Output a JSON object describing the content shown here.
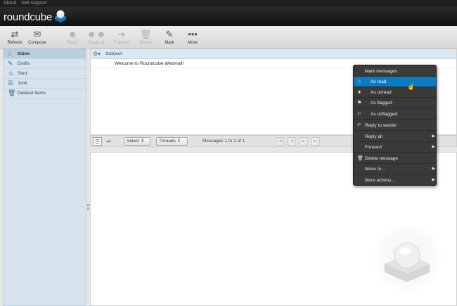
{
  "topbar": {
    "about": "About",
    "support": "Get support"
  },
  "header": {
    "logo_text": "roundcube",
    "brand_color": "#2b8bd1"
  },
  "toolbar": {
    "buttons": [
      {
        "label": "Refresh",
        "icon": "refresh-icon",
        "enabled": true
      },
      {
        "label": "Compose",
        "icon": "compose-icon",
        "enabled": true
      },
      {
        "label": "Reply",
        "icon": "reply-icon",
        "enabled": false
      },
      {
        "label": "Reply all",
        "icon": "reply-all-icon",
        "enabled": false
      },
      {
        "label": "Forward",
        "icon": "forward-icon",
        "enabled": false
      },
      {
        "label": "Delete",
        "icon": "trash-icon",
        "enabled": false
      },
      {
        "label": "Mark",
        "icon": "pencil-icon",
        "enabled": true
      },
      {
        "label": "More",
        "icon": "more-icon",
        "enabled": true
      }
    ]
  },
  "folders": [
    {
      "label": "Inbox",
      "icon": "inbox-icon",
      "active": true
    },
    {
      "label": "Drafts",
      "icon": "pencil-icon",
      "active": false
    },
    {
      "label": "Sent",
      "icon": "sent-icon",
      "active": false
    },
    {
      "label": "Junk",
      "icon": "junk-icon",
      "active": false
    },
    {
      "label": "Deleted Items",
      "icon": "trash-icon",
      "active": false
    }
  ],
  "message_list": {
    "column_subject": "Subject",
    "messages": [
      {
        "subject": "Welcome to Roundcube Webmail!"
      }
    ]
  },
  "list_footer": {
    "select_label": "Select",
    "threads_label": "Threads",
    "count_text": "Messages 1 to 1 of 1"
  },
  "context_menu": {
    "title": "Mark messages",
    "items": [
      {
        "label": "As read",
        "icon": "star-outline-icon",
        "highlighted": true
      },
      {
        "label": "As unread",
        "icon": "star-icon"
      },
      {
        "label": "As flagged",
        "icon": "flag-icon"
      },
      {
        "label": "As unflagged",
        "icon": "flag-outline-icon"
      },
      {
        "label": "Reply to sender",
        "icon": "reply-icon"
      },
      {
        "label": "Reply all",
        "submenu": true
      },
      {
        "label": "Forward",
        "submenu": true
      },
      {
        "label": "Delete message",
        "icon": "trash-icon"
      },
      {
        "label": "Move to...",
        "submenu": true
      },
      {
        "label": "More actions...",
        "submenu": true
      }
    ],
    "highlight_color": "#0b7cc2"
  }
}
